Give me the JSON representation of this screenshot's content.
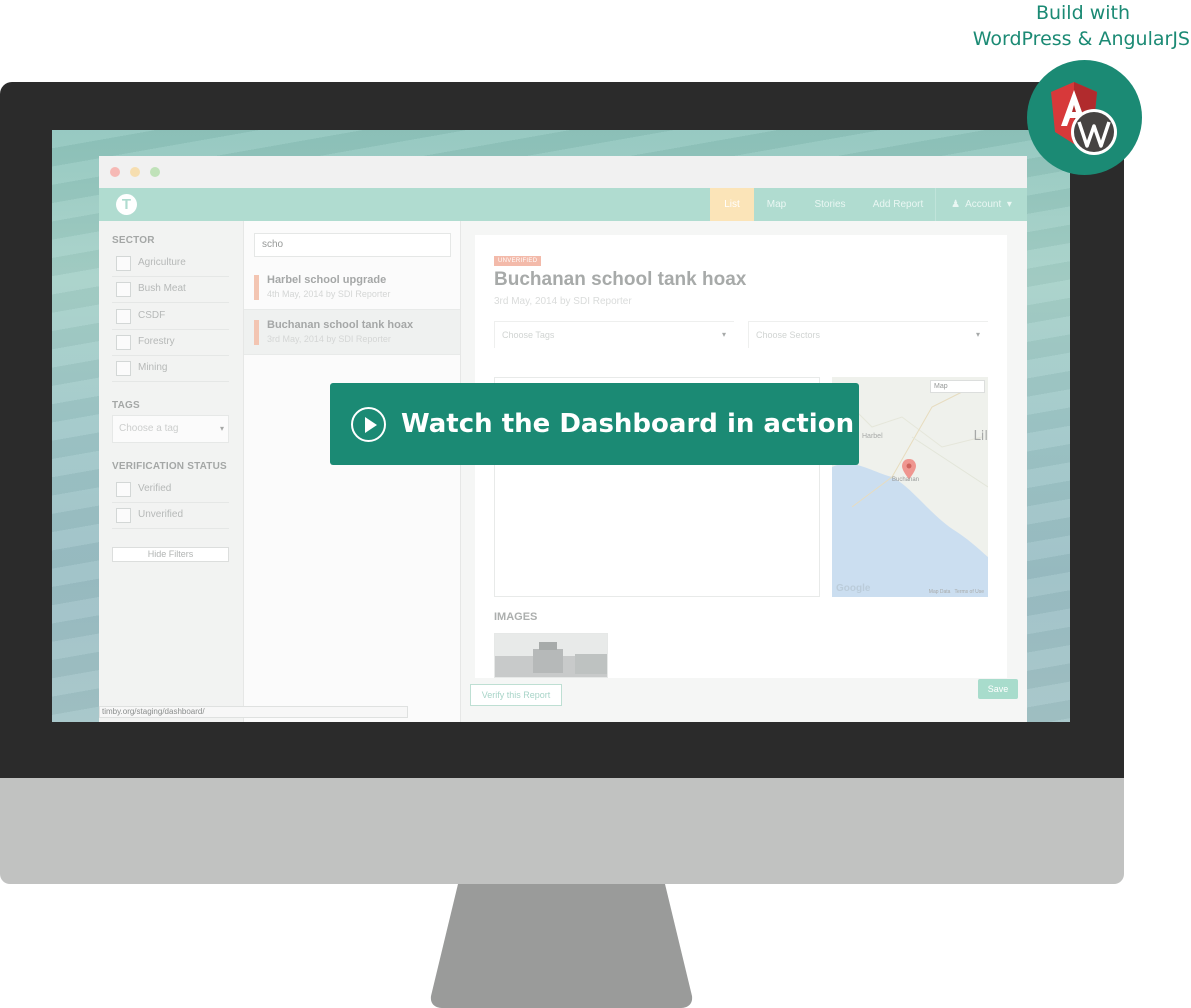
{
  "headline": {
    "line1": "Build with",
    "line2": "WordPress & AngularJS"
  },
  "badge": {
    "icons": [
      "angularjs-icon",
      "wordpress-icon"
    ],
    "color": "#1b8a74"
  },
  "cta": {
    "label": "Watch the Dashboard in action",
    "icon": "play-icon"
  },
  "app": {
    "nav": {
      "items": [
        "List",
        "Map",
        "Stories",
        "Add Report"
      ],
      "active": "List",
      "account_label": "Account",
      "account_icon": "user-icon"
    },
    "sidebar": {
      "sector_heading": "SECTOR",
      "sectors": [
        "Agriculture",
        "Bush Meat",
        "CSDF",
        "Forestry",
        "Mining"
      ],
      "tags_heading": "TAGS",
      "tag_placeholder": "Choose a tag",
      "verification_heading": "VERIFICATION STATUS",
      "verification": [
        "Verified",
        "Unverified"
      ],
      "hide_filters": "Hide Filters"
    },
    "list": {
      "search_value": "scho",
      "items": [
        {
          "title": "Harbel school upgrade",
          "meta": "4th May, 2014 by SDI Reporter"
        },
        {
          "title": "Buchanan school tank hoax",
          "meta": "3rd May, 2014 by SDI Reporter"
        }
      ]
    },
    "detail": {
      "status": "UNVERIFIED",
      "title": "Buchanan school tank hoax",
      "meta": "3rd May, 2014 by SDI Reporter",
      "tags_placeholder": "Choose Tags",
      "sectors_placeholder": "Choose Sectors",
      "map": {
        "type_select": "Map",
        "label_country": "Lil",
        "label_harbel": "Harbel",
        "label_city": "Buchanan",
        "google": "Google",
        "map_data": "Map Data",
        "terms": "Terms of Use"
      },
      "images_heading": "IMAGES",
      "verify_button": "Verify this Report",
      "save_button": "Save"
    },
    "status_url": "timby.org/staging/dashboard/"
  },
  "colors": {
    "accent": "#1b8a74",
    "nav": "#a7d8cb",
    "active_tab": "#fbe1b0",
    "unverified": "#f2b3a1"
  }
}
